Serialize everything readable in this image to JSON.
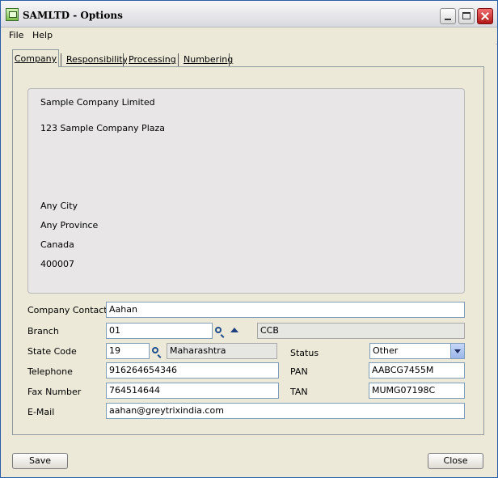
{
  "window": {
    "title": "SAMLTD - Options"
  },
  "menu": [
    "File",
    "Help"
  ],
  "tabs": [
    {
      "label": "Company",
      "selected": true
    },
    {
      "label": "Responsibility",
      "selected": false
    },
    {
      "label": "Processing",
      "selected": false
    },
    {
      "label": "Numbering",
      "selected": false
    }
  ],
  "address": {
    "name": "Sample Company Limited",
    "line1": "123 Sample Company Plaza",
    "city": "Any City",
    "province": "Any Province",
    "country": "Canada",
    "postal": "400007"
  },
  "labels": {
    "contact": "Company Contact",
    "branch": "Branch",
    "state_code": "State Code",
    "status": "Status",
    "telephone": "Telephone",
    "pan": "PAN",
    "fax": "Fax Number",
    "tan": "TAN",
    "email": "E-Mail"
  },
  "fields": {
    "contact": "Aahan",
    "branch": "01",
    "branch_desc": "CCB",
    "state_code": "19",
    "state_name": "Maharashtra",
    "status": "Other",
    "telephone": "916264654346",
    "pan": "AABCG7455M",
    "fax": "764514644",
    "tan": "MUMG07198C",
    "email": "aahan@greytrixindia.com"
  },
  "buttons": {
    "save": "Save",
    "close": "Close"
  },
  "colors": {
    "window_border": "#2b5ea9",
    "dialog_bg": "#ece9d8",
    "address_bg": "#e8e6e6",
    "close_button": "#c22b2b"
  },
  "icons": [
    "app-icon",
    "minimize-icon",
    "maximize-icon",
    "close-icon",
    "search-icon",
    "up-arrow-icon",
    "chevron-down-icon"
  ]
}
